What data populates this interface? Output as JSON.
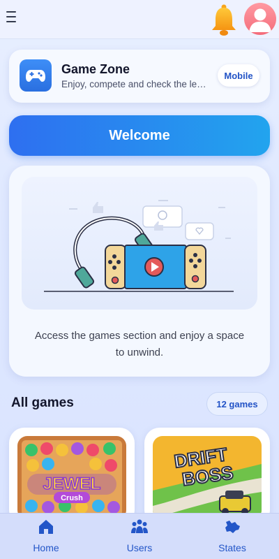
{
  "header": {
    "menu_icon": "hamburger-icon",
    "bell_icon": "bell-icon",
    "avatar_icon": "user-avatar-icon",
    "bell_color": "#f8a81b",
    "avatar_color": "#f46c7a"
  },
  "app_card": {
    "icon": "gamepad-icon",
    "title": "Game Zone",
    "subtitle": "Enjoy, compete and check the lea...",
    "platform_label": "Mobile"
  },
  "welcome": {
    "label": "Welcome",
    "gradient_start": "#2e6ff0",
    "gradient_end": "#22a4ee"
  },
  "promo": {
    "illustration": "gaming-console-headphones-illustration",
    "text": "Access the games section and enjoy a space to unwind."
  },
  "games_section": {
    "title": "All games",
    "count_label": "12 games",
    "games": [
      {
        "title_line1": "JEWEL",
        "title_line2": "Crush"
      },
      {
        "title_line1": "DRIFT",
        "title_line2": "BOSS"
      }
    ]
  },
  "bottom_nav": {
    "items": [
      {
        "label": "Home",
        "icon": "home-icon"
      },
      {
        "label": "Users",
        "icon": "users-icon"
      },
      {
        "label": "States",
        "icon": "map-icon"
      }
    ],
    "accent": "#2356c8"
  }
}
